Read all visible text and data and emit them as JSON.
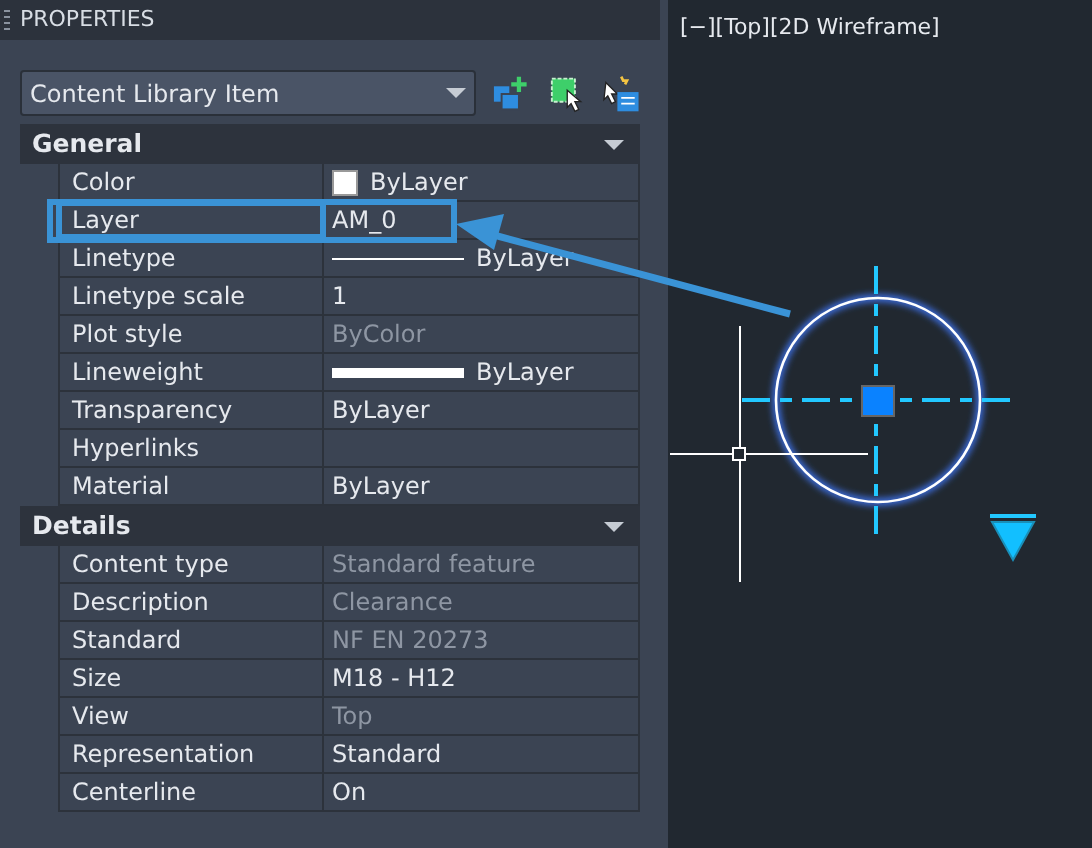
{
  "panel": {
    "title": "PROPERTIES",
    "selector": {
      "value": "Content Library Item"
    }
  },
  "sections": [
    {
      "title": "General",
      "expanded": true,
      "rows": [
        {
          "label": "Color",
          "value": "ByLayer",
          "kind": "color",
          "disabled": false,
          "highlighted": false
        },
        {
          "label": "Layer",
          "value": "AM_0",
          "kind": "text",
          "disabled": false,
          "highlighted": true
        },
        {
          "label": "Linetype",
          "value": "ByLayer",
          "kind": "linetype",
          "disabled": false,
          "highlighted": false
        },
        {
          "label": "Linetype scale",
          "value": "1",
          "kind": "text",
          "disabled": false,
          "highlighted": false
        },
        {
          "label": "Plot style",
          "value": "ByColor",
          "kind": "text",
          "disabled": true,
          "highlighted": false
        },
        {
          "label": "Lineweight",
          "value": "ByLayer",
          "kind": "lineweight",
          "disabled": false,
          "highlighted": false
        },
        {
          "label": "Transparency",
          "value": "ByLayer",
          "kind": "text",
          "disabled": false,
          "highlighted": false
        },
        {
          "label": "Hyperlinks",
          "kind": "text",
          "disabled": false,
          "highlighted": false
        },
        {
          "label": "Material",
          "value": "ByLayer",
          "kind": "text",
          "disabled": false,
          "highlighted": false
        }
      ]
    },
    {
      "title": "Details",
      "expanded": true,
      "rows": [
        {
          "label": "Content type",
          "value": "Standard feature",
          "kind": "text",
          "disabled": true,
          "highlighted": false
        },
        {
          "label": "Description",
          "value": "Clearance",
          "kind": "text",
          "disabled": true,
          "highlighted": false
        },
        {
          "label": "Standard",
          "value": "NF EN 20273",
          "kind": "text",
          "disabled": true,
          "highlighted": false
        },
        {
          "label": "Size",
          "value": "M18 - H12",
          "kind": "text",
          "disabled": false,
          "highlighted": false
        },
        {
          "label": "View",
          "value": "Top",
          "kind": "text",
          "disabled": true,
          "highlighted": false
        },
        {
          "label": "Representation",
          "value": "Standard",
          "kind": "text",
          "disabled": false,
          "highlighted": false
        },
        {
          "label": "Centerline",
          "value": "On",
          "kind": "text",
          "disabled": false,
          "highlighted": false
        }
      ]
    }
  ],
  "viewport": {
    "label": "[−][Top][2D Wireframe]"
  }
}
